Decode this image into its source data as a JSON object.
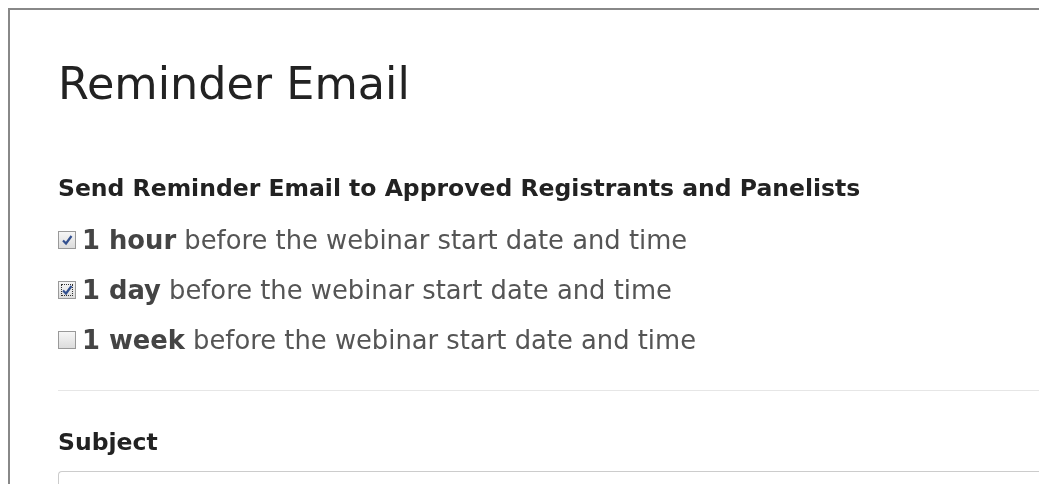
{
  "title": "Reminder Email",
  "reminders": {
    "heading": "Send Reminder Email to Approved Registrants and Panelists",
    "options": [
      {
        "label": "**1 hour** before the webinar start date and time",
        "checked": true,
        "focused": false
      },
      {
        "label": "**1 day** before the webinar start date and time",
        "checked": true,
        "focused": true
      },
      {
        "label": "**1 week** before the webinar start date and time",
        "checked": false,
        "focused": false
      }
    ]
  },
  "subject": {
    "label": "Subject"
  }
}
